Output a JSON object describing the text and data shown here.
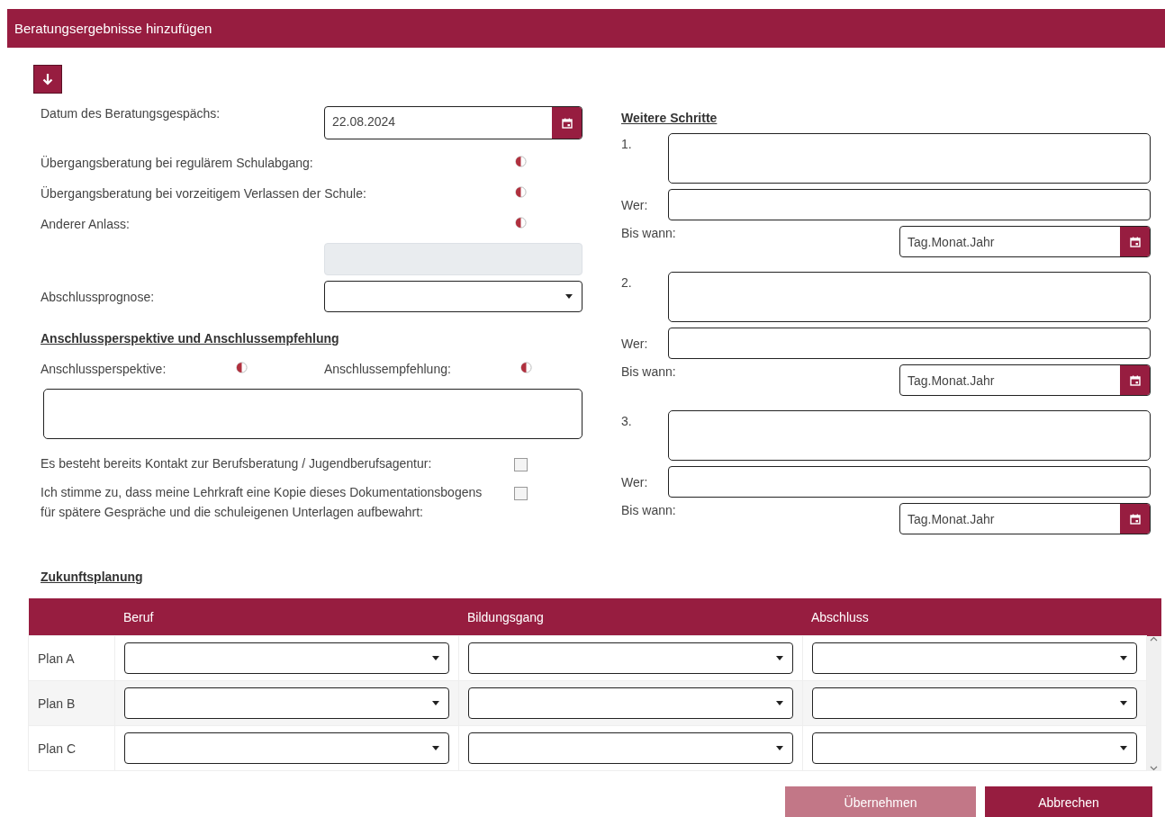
{
  "window": {
    "title": "Beratungsergebnisse hinzufügen"
  },
  "consultation": {
    "date": {
      "label": "Datum des Beratungsgespächs:",
      "value": "22.08.2024"
    },
    "occasions": [
      {
        "label": "Übergangsberatung bei regulärem Schulabgang:"
      },
      {
        "label": "Übergangsberatung bei vorzeitigem Verlassen der Schule:"
      },
      {
        "label": "Anderer Anlass:"
      }
    ],
    "other_occasion_field": {
      "disabled": true
    },
    "prognosis": {
      "label": "Abschlussprognose:"
    }
  },
  "follow_up": {
    "heading": "Anschlussperspektive und Anschlussempfehlung",
    "perspective": {
      "label": "Anschlussperspektive:"
    },
    "recommendation": {
      "label": "Anschlussempfehlung:"
    },
    "consents": [
      {
        "label": "Es besteht bereits Kontakt zur Berufsberatung / Jugendberufsagentur:",
        "checked": false
      },
      {
        "label": "Ich stimme zu, dass meine Lehrkraft eine Kopie dieses Dokumentationsbogens für spätere Gespräche und die schuleigenen Unterlagen aufbewahrt:",
        "checked": false
      }
    ]
  },
  "next_steps": {
    "heading": "Weitere Schritte",
    "steps": [
      {
        "number": "1.",
        "who_label": "Wer:",
        "due_label": "Bis wann:",
        "due_placeholder": "Tag.Monat.Jahr"
      },
      {
        "number": "2.",
        "who_label": "Wer:",
        "due_label": "Bis wann:",
        "due_placeholder": "Tag.Monat.Jahr"
      },
      {
        "number": "3.",
        "who_label": "Wer:",
        "due_label": "Bis wann:",
        "due_placeholder": "Tag.Monat.Jahr"
      }
    ]
  },
  "planning": {
    "heading": "Zukunftsplanung",
    "columns": [
      "Beruf",
      "Bildungsgang",
      "Abschluss"
    ],
    "rows": [
      {
        "label": "Plan A"
      },
      {
        "label": "Plan B"
      },
      {
        "label": "Plan C"
      }
    ]
  },
  "buttons": [
    {
      "label": "Übernehmen",
      "disabled": true
    },
    {
      "label": "Abbrechen",
      "disabled": false
    }
  ]
}
